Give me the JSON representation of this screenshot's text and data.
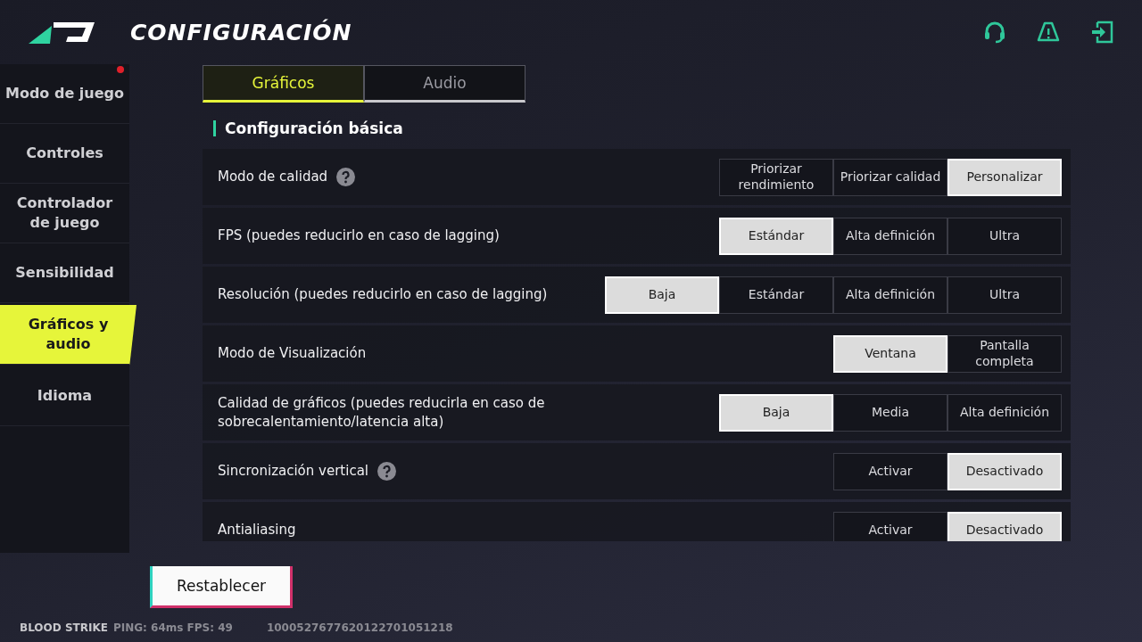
{
  "header": {
    "title": "CONFIGURACIÓN"
  },
  "sidebar": {
    "items": [
      {
        "label": "Modo de juego",
        "selected": false,
        "notification": true
      },
      {
        "label": "Controles",
        "selected": false,
        "notification": false
      },
      {
        "label": "Controlador de juego",
        "selected": false,
        "notification": false
      },
      {
        "label": "Sensibilidad",
        "selected": false,
        "notification": false
      },
      {
        "label": "Gráficos y audio",
        "selected": true,
        "notification": false
      },
      {
        "label": "Idioma",
        "selected": false,
        "notification": false
      }
    ]
  },
  "tabs": [
    {
      "label": "Gráficos",
      "selected": true
    },
    {
      "label": "Audio",
      "selected": false
    }
  ],
  "section": {
    "title": "Configuración básica"
  },
  "settings": [
    {
      "label": "Modo de calidad",
      "help": true,
      "options": [
        {
          "label": "Priorizar rendimiento",
          "selected": false
        },
        {
          "label": "Priorizar calidad",
          "selected": false
        },
        {
          "label": "Personalizar",
          "selected": true
        }
      ]
    },
    {
      "label": "FPS (puedes reducirlo en caso de lagging)",
      "help": false,
      "options": [
        {
          "label": "Estándar",
          "selected": true
        },
        {
          "label": "Alta definición",
          "selected": false
        },
        {
          "label": "Ultra",
          "selected": false
        }
      ]
    },
    {
      "label": "Resolución (puedes reducirlo en caso de lagging)",
      "help": false,
      "options": [
        {
          "label": "Baja",
          "selected": true
        },
        {
          "label": "Estándar",
          "selected": false
        },
        {
          "label": "Alta definición",
          "selected": false
        },
        {
          "label": "Ultra",
          "selected": false
        }
      ]
    },
    {
      "label": "Modo de Visualización",
      "help": false,
      "options": [
        {
          "label": "Ventana",
          "selected": true
        },
        {
          "label": "Pantalla completa",
          "selected": false
        }
      ]
    },
    {
      "label": "Calidad de gráficos (puedes reducirla en caso de sobrecalentamiento/latencia alta)",
      "help": false,
      "options": [
        {
          "label": "Baja",
          "selected": true
        },
        {
          "label": "Media",
          "selected": false
        },
        {
          "label": "Alta definición",
          "selected": false
        }
      ]
    },
    {
      "label": "Sincronización vertical",
      "help": true,
      "options": [
        {
          "label": "Activar",
          "selected": false
        },
        {
          "label": "Desactivado",
          "selected": true
        }
      ]
    },
    {
      "label": "Antialiasing",
      "help": false,
      "options": [
        {
          "label": "Activar",
          "selected": false
        },
        {
          "label": "Desactivado",
          "selected": true
        }
      ]
    }
  ],
  "reset_button": "Restablecer",
  "footer": {
    "game": "BLOOD STRIKE",
    "stats": "PING: 64ms FPS: 49",
    "id": "1000527677620122701051218"
  }
}
